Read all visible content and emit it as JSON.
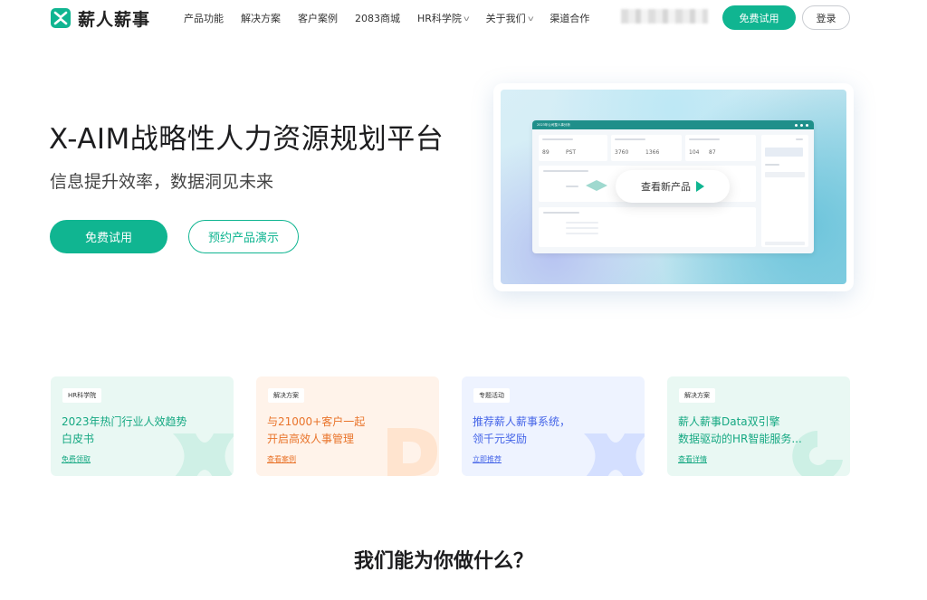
{
  "brand": {
    "name": "薪人薪事",
    "color": "#10b591"
  },
  "nav": {
    "items": [
      {
        "label": "产品功能",
        "dropdown": false
      },
      {
        "label": "解决方案",
        "dropdown": false
      },
      {
        "label": "客户案例",
        "dropdown": false
      },
      {
        "label": "2083商城",
        "dropdown": false
      },
      {
        "label": "HR科学院",
        "dropdown": true
      },
      {
        "label": "关于我们",
        "dropdown": true
      },
      {
        "label": "渠道合作",
        "dropdown": false
      }
    ],
    "trial_label": "免费试用",
    "login_label": "登录"
  },
  "hero": {
    "title": "X-AIM战略性人力资源规划平台",
    "subtitle": "信息提升效率，数据洞见未来",
    "trial_label": "免费试用",
    "demo_label": "预约产品演示",
    "preview_button": "查看新产品",
    "preview_window_title": "2023年公司整人事分析",
    "preview_numbers": [
      "89",
      "PST",
      "3760",
      "1366",
      "104",
      "87"
    ]
  },
  "cards": [
    {
      "tag": "HR科学院",
      "line1": "2023年热门行业人效趋势",
      "line2": "白皮书",
      "link": "免费领取"
    },
    {
      "tag": "解决方案",
      "line1": "与21000+客户一起",
      "line2": "开启高效人事管理",
      "link": "查看案例"
    },
    {
      "tag": "专题活动",
      "line1": "推荐薪人薪事系统，",
      "line2": "领千元奖励",
      "link": "立即推荐"
    },
    {
      "tag": "解决方案",
      "line1": "薪人薪事Data双引擎",
      "line2": "数据驱动的HR智能服务...",
      "link": "查看详情"
    }
  ],
  "section": {
    "title": "我们能为你做什么？"
  }
}
